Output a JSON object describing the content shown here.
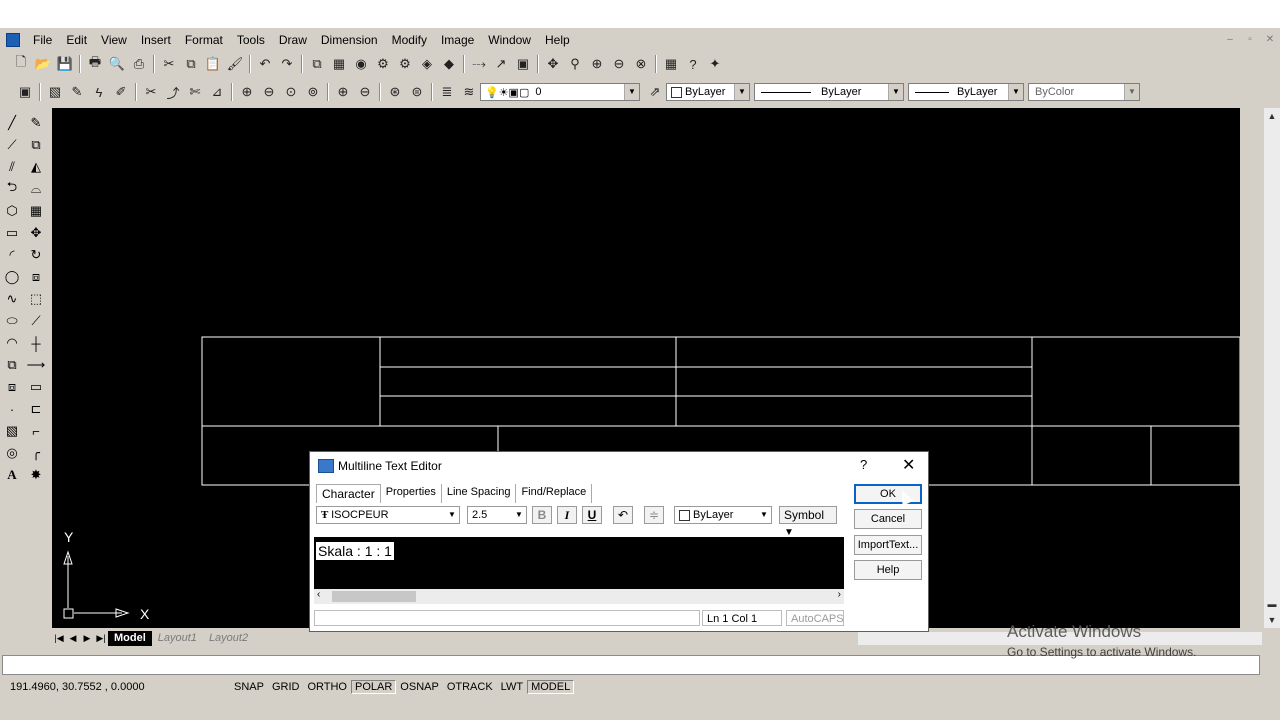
{
  "menu": [
    "File",
    "Edit",
    "View",
    "Insert",
    "Format",
    "Tools",
    "Draw",
    "Dimension",
    "Modify",
    "Image",
    "Window",
    "Help"
  ],
  "window_controls": [
    "–",
    "▫",
    "✕"
  ],
  "toolbar_props": {
    "layer_value": "0",
    "color": "ByLayer",
    "linetype": "ByLayer",
    "lineweight": "ByLayer",
    "plotstyle": "ByColor"
  },
  "ucs": {
    "y_label": "Y",
    "x_label": "X"
  },
  "layout_tabs": [
    "Model",
    "Layout1",
    "Layout2"
  ],
  "status": {
    "coords": "191.4960, 30.7552 , 0.0000",
    "toggles": [
      {
        "label": "SNAP",
        "on": false
      },
      {
        "label": "GRID",
        "on": false
      },
      {
        "label": "ORTHO",
        "on": false
      },
      {
        "label": "POLAR",
        "on": true
      },
      {
        "label": "OSNAP",
        "on": false
      },
      {
        "label": "OTRACK",
        "on": false
      },
      {
        "label": "LWT",
        "on": false
      },
      {
        "label": "MODEL",
        "on": true
      }
    ]
  },
  "dialog": {
    "title": "Multiline Text Editor",
    "help": "?",
    "close": "✕",
    "tabs": [
      "Character",
      "Properties",
      "Line Spacing",
      "Find/Replace"
    ],
    "font": "ISOCPEUR",
    "height": "2.5",
    "bold": "B",
    "italic": "I",
    "underline": "U",
    "color": "ByLayer",
    "symbol": "Symbol",
    "text": "Skala : 1 : 1",
    "position": "Ln 1 Col 1",
    "autocaps": "AutoCAPS",
    "buttons": {
      "ok": "OK",
      "cancel": "Cancel",
      "import": "ImportText...",
      "help": "Help"
    }
  },
  "watermark": {
    "line1": "Activate Windows",
    "line2": "Go to Settings to activate Windows."
  },
  "colors": {
    "canvas": "#000000",
    "frame": "#d4d0c8",
    "accent": "#0a64c8"
  }
}
